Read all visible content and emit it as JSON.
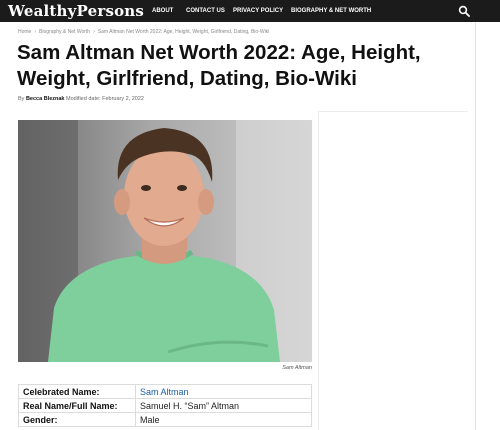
{
  "header": {
    "logo": "WealthyPersons",
    "nav": [
      "ABOUT",
      "CONTACT US",
      "PRIVACY POLICY",
      "BIOGRAPHY & NET WORTH"
    ],
    "search_icon": "search-icon"
  },
  "breadcrumb": [
    "Home",
    "Biography & Net Worth",
    "Sam Altman Net Worth 2022: Age, Height, Weight, Girlfriend, Dating, Bio-Wiki"
  ],
  "article": {
    "title": "Sam Altman Net Worth 2022: Age, Height, Weight, Girlfriend, Dating, Bio-Wiki",
    "by": "By",
    "author": "Becca Bleznak",
    "modified": "Modified date: February 2, 2022",
    "image_caption": "Sam Altman"
  },
  "info_table": [
    {
      "label": "Celebrated Name:",
      "value": "Sam Altman"
    },
    {
      "label": "Real Name/Full Name:",
      "value": "Samuel H. “Sam” Altman"
    },
    {
      "label": "Gender:",
      "value": "Male"
    }
  ],
  "colors": {
    "header_bg": "#1b1b1b",
    "link": "#1e5fa8",
    "shirt": "#7fcf9c"
  }
}
